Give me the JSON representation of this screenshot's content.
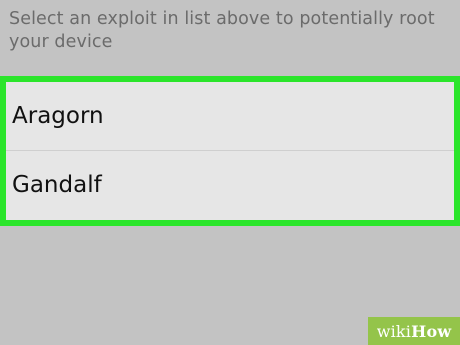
{
  "instruction": {
    "text": "Select an exploit in list above to potentially root your device"
  },
  "exploit_list": {
    "items": [
      {
        "label": "Aragorn"
      },
      {
        "label": "Gandalf"
      }
    ],
    "highlight_color": "#2be52b"
  },
  "watermark": {
    "prefix": "wiki",
    "suffix": "How"
  },
  "colors": {
    "background": "#c3c3c3",
    "list_background": "#e6e6e6",
    "watermark_background": "#94c44a"
  }
}
